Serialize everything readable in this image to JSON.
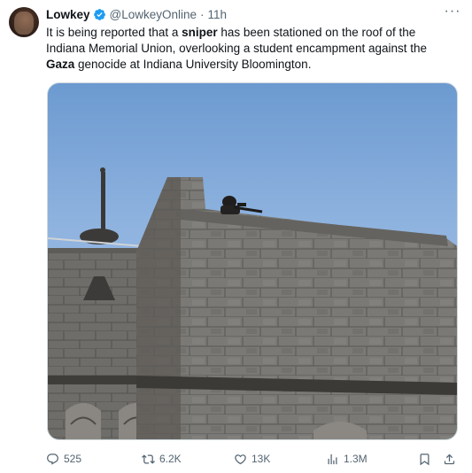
{
  "author": {
    "name": "Lowkey",
    "handle": "@LowkeyOnline",
    "separator": "·",
    "time": "11h"
  },
  "tweet": {
    "t1": "It is being reported that a ",
    "t2": "sniper",
    "t3": " has been stationed on the roof of the Indiana Memorial Union, overlooking a student encampment against the ",
    "t4": "Gaza",
    "t5": " genocide at Indiana University Bloomington."
  },
  "stats": {
    "replies": "525",
    "reposts": "6.2K",
    "likes": "13K",
    "views": "1.3M"
  },
  "icons": {
    "verified": "verified-badge-icon",
    "more": "more-options-icon",
    "reply": "reply-icon",
    "repost": "repost-icon",
    "like": "heart-icon",
    "views": "views-chart-icon",
    "bookmark": "bookmark-icon",
    "share": "share-icon"
  },
  "colors": {
    "verified": "#1d9bf0",
    "text": "#0f1419",
    "secondary": "#536471",
    "sky": "#7ea6d9",
    "stone": "#7a7874"
  }
}
